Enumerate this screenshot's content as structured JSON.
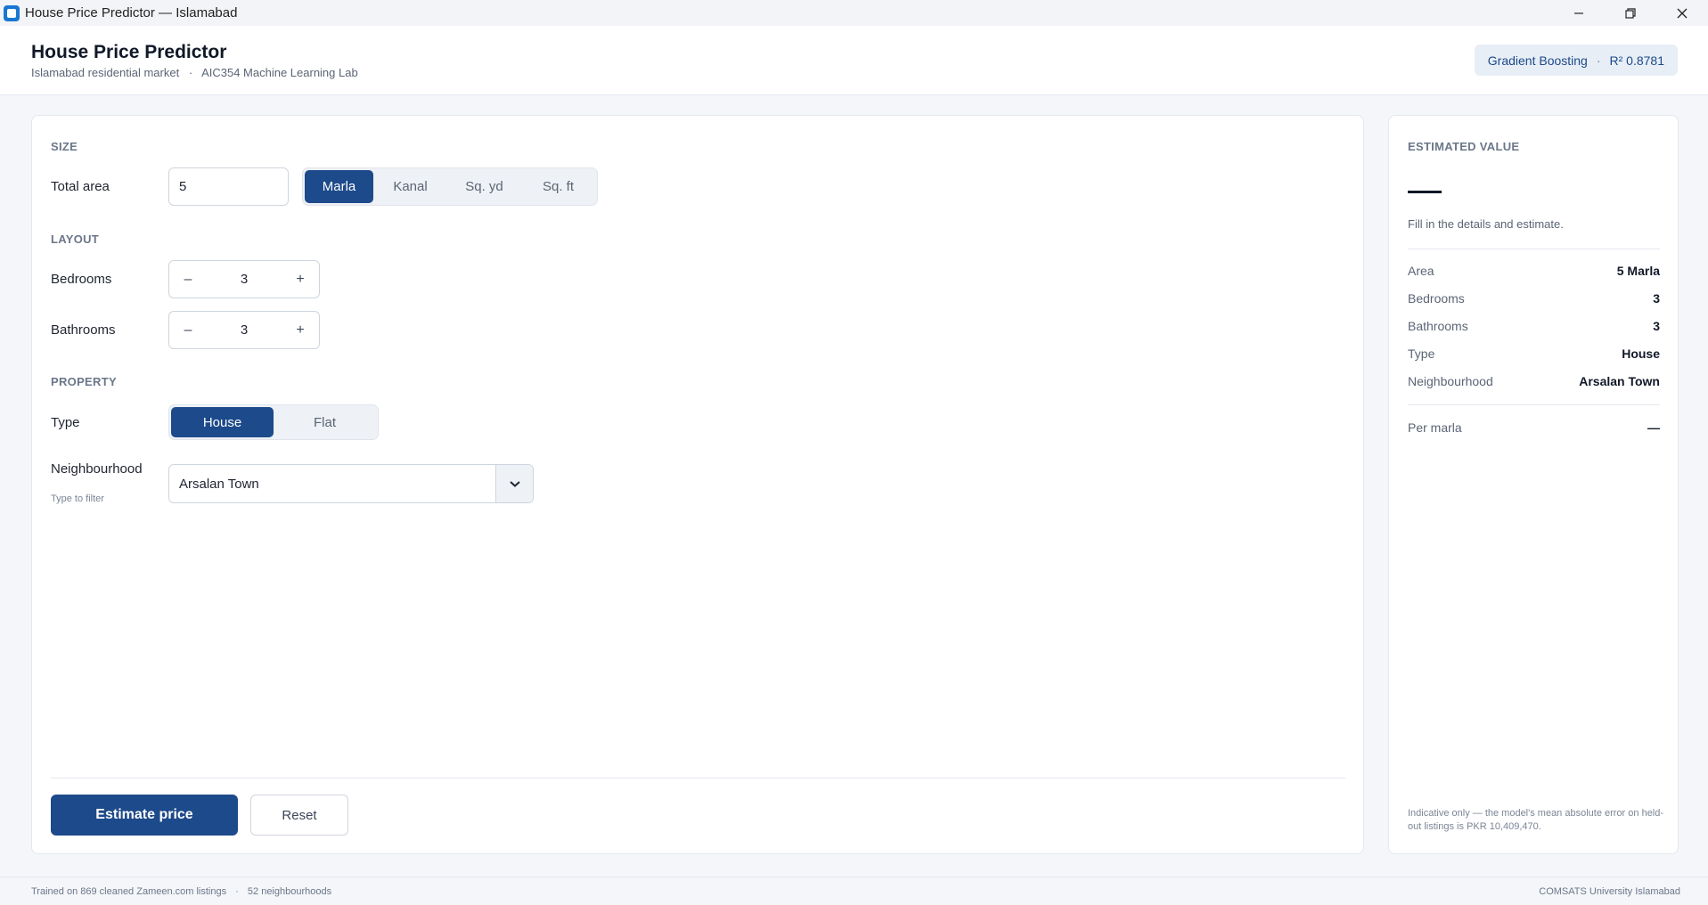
{
  "window": {
    "title": "House Price Predictor — Islamabad",
    "controls": [
      "minimize-icon",
      "restore-icon",
      "close-icon"
    ]
  },
  "header": {
    "title": "House Price Predictor",
    "subtitle_market": "Islamabad residential market",
    "subtitle_separator": "·",
    "subtitle_lab": "AIC354 Machine Learning Lab",
    "model_name": "Gradient Boosting",
    "model_separator": "·",
    "model_score": "R² 0.8781"
  },
  "form": {
    "size_section": "SIZE",
    "total_area_label": "Total area",
    "total_area_value": "5",
    "units": [
      "Marla",
      "Kanal",
      "Sq. yd",
      "Sq. ft"
    ],
    "selected_unit": "Marla",
    "layout_section": "LAYOUT",
    "bedrooms_label": "Bedrooms",
    "bedrooms_value": "3",
    "bathrooms_label": "Bathrooms",
    "bathrooms_value": "3",
    "minus_symbol": "–",
    "plus_symbol": "+",
    "property_section": "PROPERTY",
    "type_label": "Type",
    "types": [
      "House",
      "Flat"
    ],
    "selected_type": "House",
    "neighbourhood_label": "Neighbourhood",
    "neighbourhood_hint": "Type to filter",
    "neighbourhood_value": "Arsalan Town",
    "estimate_button": "Estimate price",
    "reset_button": "Reset"
  },
  "result": {
    "section": "ESTIMATED VALUE",
    "hint": "Fill in the details and estimate.",
    "summary": [
      {
        "key": "Area",
        "value": "5 Marla"
      },
      {
        "key": "Bedrooms",
        "value": "3"
      },
      {
        "key": "Bathrooms",
        "value": "3"
      },
      {
        "key": "Type",
        "value": "House"
      },
      {
        "key": "Neighbourhood",
        "value": "Arsalan Town"
      }
    ],
    "per_marla_label": "Per marla",
    "per_marla_value": "—",
    "disclaimer": "Indicative only — the model's mean absolute error on held-out listings is PKR 10,409,470."
  },
  "footer": {
    "trained_on": "Trained on 869 cleaned Zameen.com listings",
    "separator": "·",
    "neighbourhoods": "52 neighbourhoods",
    "institution": "COMSATS University Islamabad"
  },
  "colors": {
    "accent": "#1d4a8a",
    "background": "#f4f6f9",
    "card": "#ffffff"
  }
}
